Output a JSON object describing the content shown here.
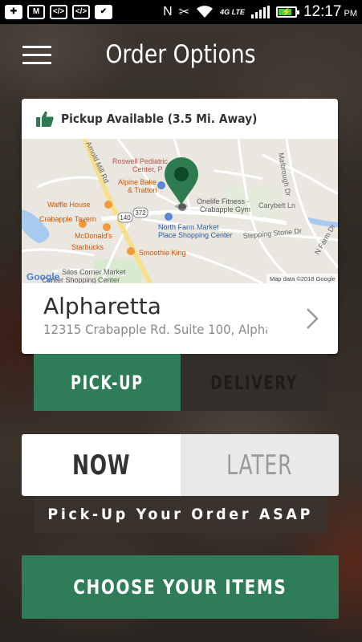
{
  "statusbar": {
    "time": "12:17",
    "ampm": "PM",
    "network_label": "4G LTE",
    "icons": [
      "add-icon",
      "gmail-icon",
      "code-icon",
      "code-icon",
      "check-icon",
      "nfc-icon",
      "mute-icon",
      "wifi-icon",
      "signal-icon",
      "battery-icon"
    ]
  },
  "header": {
    "title": "Order Options",
    "menu_icon": "hamburger-icon"
  },
  "location_card": {
    "availability_icon": "thumbs-up-icon",
    "availability_text": "Pickup Available (3.5 Mi. Away)",
    "map": {
      "labels": {
        "roswell": "Roswell Pediatric",
        "roswell2": "Center, P",
        "alpine": "Alpine Bake",
        "alpine2": "& Trattori",
        "onelife": "Onelife Fitness -",
        "onelife2": "Crabapple Gym",
        "waffle": "Waffle House",
        "tavern": "Crabapple Tavern",
        "mcd": "McDonald's",
        "starbucks": "Starbucks",
        "nfm": "North Farm Market",
        "nfm2": "Place Shopping Center",
        "smoothie": "Smoothie King",
        "silos": "Silos Corner Market",
        "silos2": "Center Shopping Center",
        "arnold": "Arnold Mill Rd",
        "malbrough": "Malbrough Dr",
        "carybelt": "Carybelt Ln",
        "stepping": "Stepping Stone Dr",
        "nfarm": "N Farm Dr",
        "r140": "140",
        "r372": "372",
        "google": "Google",
        "mapdata": "Map data ©2018 Google"
      }
    },
    "location_name": "Alpharetta",
    "address": "12315 Crabapple Rd. Suite 100, Alpha...",
    "chevron_icon": "chevron-right-icon"
  },
  "fulfillment": {
    "pickup_label": "PICK-UP",
    "delivery_label": "DELIVERY",
    "selected": "PICK-UP"
  },
  "timing": {
    "now_label": "NOW",
    "later_label": "LATER",
    "selected": "NOW",
    "note": "Pick-Up Your Order ASAP"
  },
  "cta": {
    "label": "CHOOSE YOUR ITEMS"
  },
  "colors": {
    "accent_green": "#2f7d58",
    "pin_green": "#2e7b4f",
    "battery_green": "#3ecf3e"
  }
}
